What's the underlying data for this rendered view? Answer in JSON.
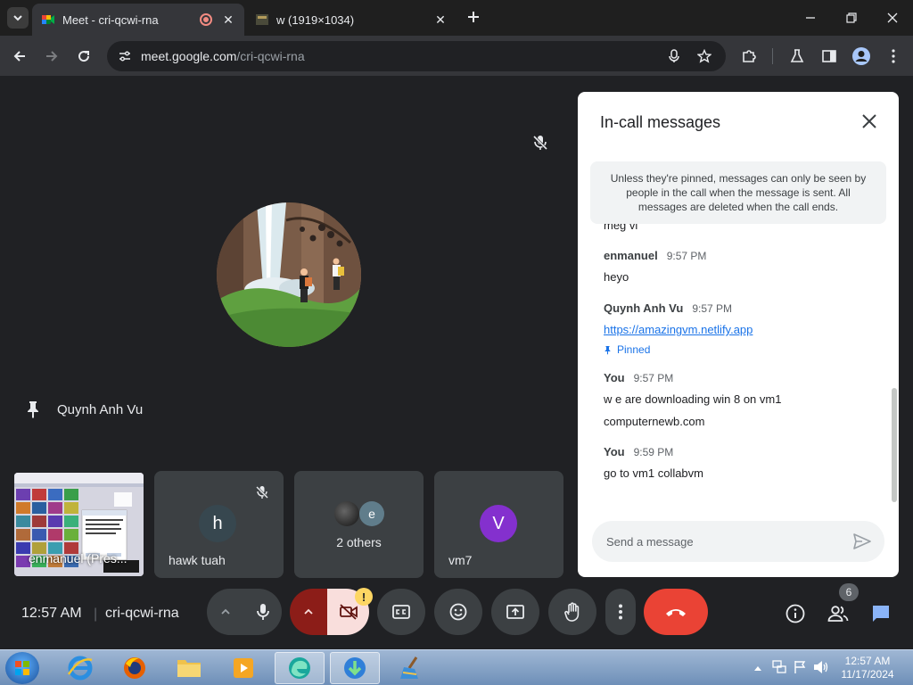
{
  "browser": {
    "tabs": [
      {
        "title": "Meet - cri-qcwi-rna",
        "active": true
      },
      {
        "title": "w (1919×1034)",
        "active": false
      }
    ],
    "url_host": "meet.google.com",
    "url_path": "/cri-qcwi-rna"
  },
  "stage": {
    "pinned_name": "Quynh Anh Vu",
    "tiles": [
      {
        "name": "enmanuel (Pres...",
        "kind": "screen"
      },
      {
        "name": "hawk tuah",
        "initial": "h",
        "color": "#37474f"
      },
      {
        "name": "2 others",
        "initials": [
          "",
          "e"
        ]
      },
      {
        "name": "vm7",
        "initial": "V",
        "color": "#8430ce"
      }
    ]
  },
  "chat": {
    "title": "In-call messages",
    "notice": "Unless they're pinned, messages can only be seen by people in the call when the message is sent. All messages are deleted when the call ends.",
    "clipped_text": "meg   vi",
    "messages": [
      {
        "sender": "enmanuel",
        "time": "9:57 PM",
        "lines": [
          "heyo"
        ]
      },
      {
        "sender": "Quynh Anh Vu",
        "time": "9:57 PM",
        "link": "https://amazingvm.netlify.app",
        "pinned_label": "Pinned"
      },
      {
        "sender": "You",
        "time": "9:57 PM",
        "lines": [
          "w e are downloading win 8 on vm1",
          "computernewb.com"
        ]
      },
      {
        "sender": "You",
        "time": "9:59 PM",
        "lines": [
          "go to vm1 collabvm"
        ]
      }
    ],
    "compose_placeholder": "Send a message"
  },
  "controls": {
    "time": "12:57 AM",
    "meeting_code": "cri-qcwi-rna",
    "separator": "|",
    "people_count": "6",
    "warning_badge": "!"
  },
  "taskbar": {
    "clock_time": "12:57 AM",
    "clock_date": "11/17/2024"
  },
  "colors": {
    "meet_bg": "#202124",
    "tile_bg": "#3c4043",
    "end_call": "#ea4335",
    "accent": "#1a73e8",
    "chat_icon": "#8ab4f8"
  }
}
